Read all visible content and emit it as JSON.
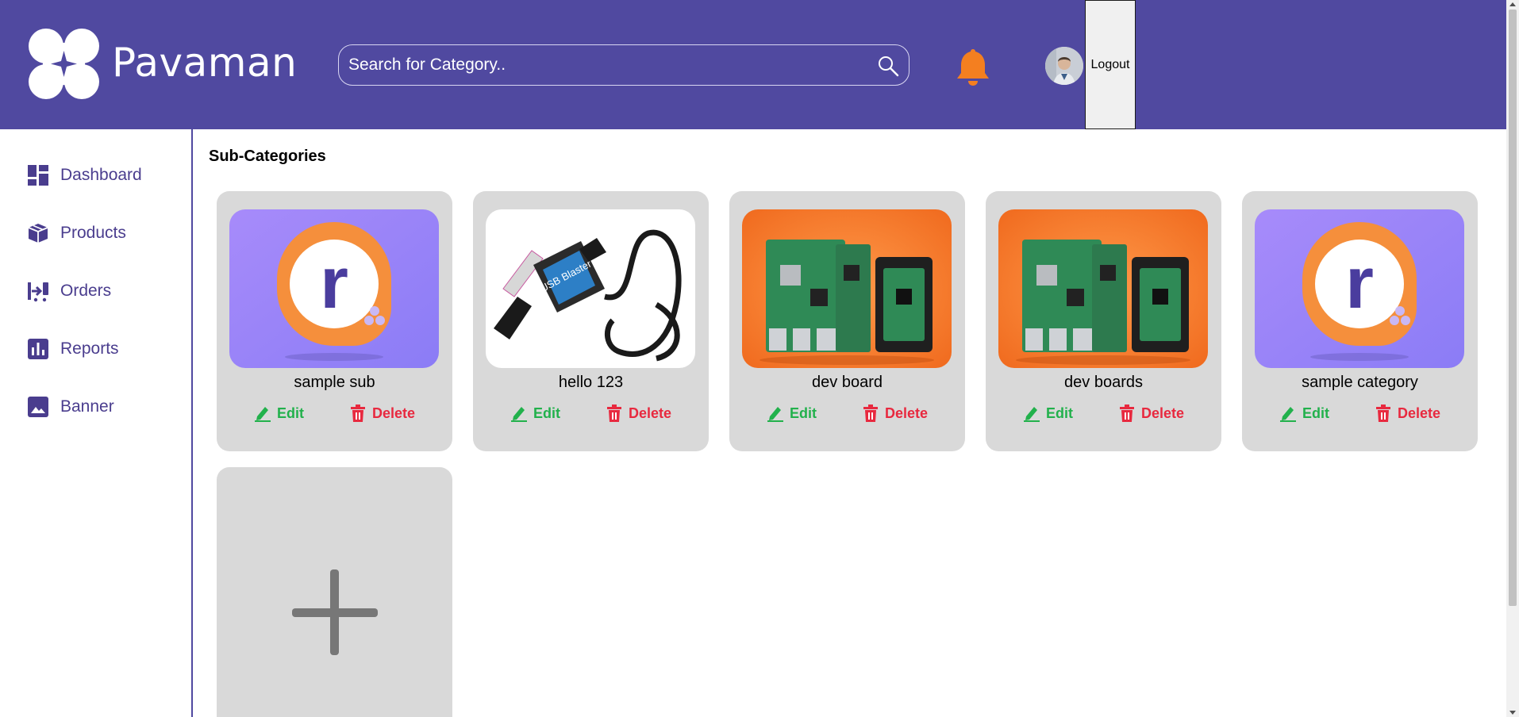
{
  "header": {
    "brand": "Pavaman",
    "search_placeholder": "Search for Category..",
    "logout_label": "Logout"
  },
  "sidebar": {
    "items": [
      {
        "label": "Dashboard",
        "icon": "dashboard-icon"
      },
      {
        "label": "Products",
        "icon": "box-icon"
      },
      {
        "label": "Orders",
        "icon": "orders-icon"
      },
      {
        "label": "Reports",
        "icon": "bar-chart-icon"
      },
      {
        "label": "Banner",
        "icon": "image-icon"
      }
    ]
  },
  "main": {
    "title": "Sub-Categories",
    "cards": [
      {
        "name": "sample sub",
        "image": "orange-r-logo"
      },
      {
        "name": "hello 123",
        "image": "usb-blaster"
      },
      {
        "name": "dev board",
        "image": "dev-boards"
      },
      {
        "name": "dev boards",
        "image": "dev-boards"
      },
      {
        "name": "sample category",
        "image": "orange-r-logo"
      }
    ],
    "edit_label": "Edit",
    "delete_label": "Delete"
  },
  "colors": {
    "header_bg": "#5049a0",
    "bell": "#f47f20",
    "edit": "#22b14c",
    "delete": "#e8293f",
    "card_bg": "#d9d9d9"
  }
}
